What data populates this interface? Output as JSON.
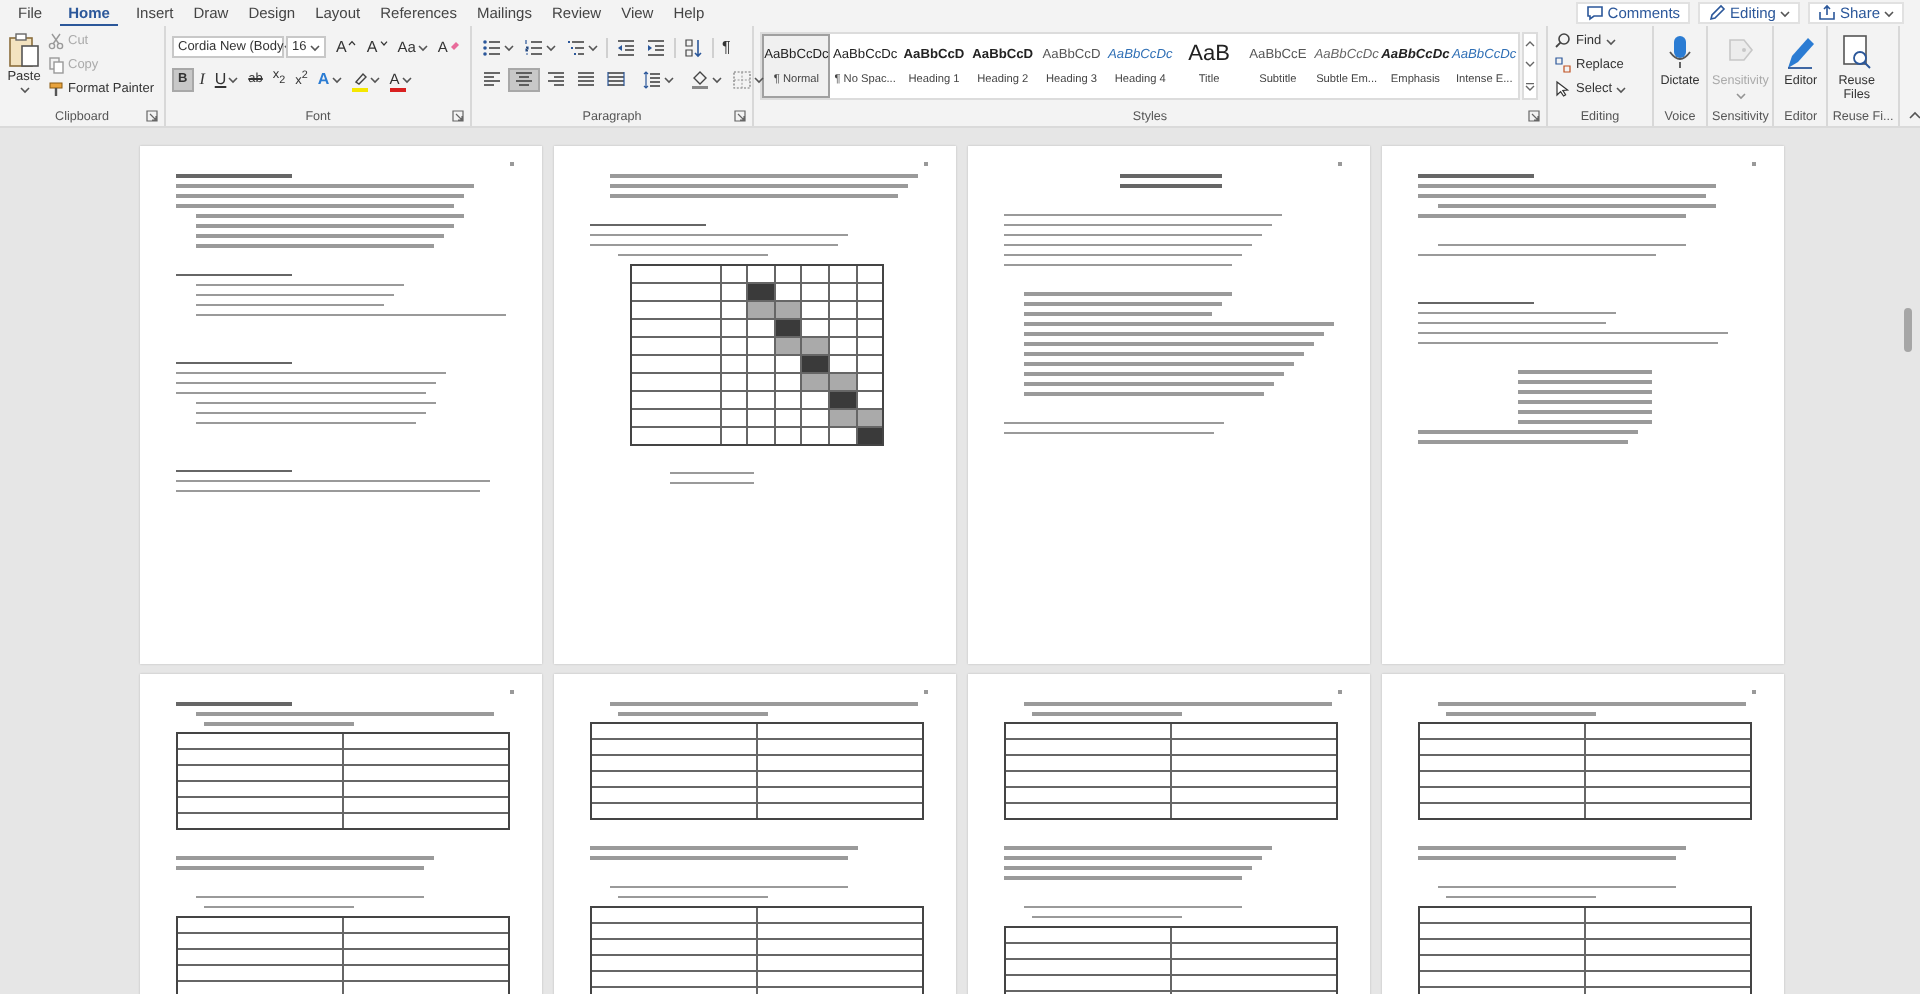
{
  "menu_tabs": [
    {
      "label": "File",
      "selected": false
    },
    {
      "label": "Home",
      "selected": true
    },
    {
      "label": "Insert",
      "selected": false
    },
    {
      "label": "Draw",
      "selected": false
    },
    {
      "label": "Design",
      "selected": false
    },
    {
      "label": "Layout",
      "selected": false
    },
    {
      "label": "References",
      "selected": false
    },
    {
      "label": "Mailings",
      "selected": false
    },
    {
      "label": "Review",
      "selected": false
    },
    {
      "label": "View",
      "selected": false
    },
    {
      "label": "Help",
      "selected": false
    }
  ],
  "header_buttons": [
    {
      "label": "Comments",
      "kind": "comments"
    },
    {
      "label": "Editing",
      "kind": "editing"
    },
    {
      "label": "Share",
      "kind": "share"
    }
  ],
  "clipboard": {
    "paste": "Paste",
    "label": "Clipboard",
    "items": [
      {
        "label": "Cut",
        "kind": "cut",
        "disabled": true
      },
      {
        "label": "Copy",
        "kind": "copy",
        "disabled": true
      },
      {
        "label": "Format Painter",
        "kind": "painter",
        "disabled": false
      }
    ]
  },
  "font": {
    "label": "Font",
    "font_name": "Cordia New (Body",
    "font_size": "16",
    "row1": [
      {
        "label": "A",
        "kind": "grow"
      },
      {
        "label": "A",
        "kind": "shrink"
      },
      {
        "label": "Aa",
        "kind": "case"
      },
      {
        "label": "A",
        "kind": "clear"
      }
    ],
    "row2": [
      {
        "label": "B",
        "kind": "bold",
        "selected": true
      },
      {
        "label": "I",
        "kind": "italic",
        "selected": false
      },
      {
        "label": "U",
        "kind": "underline",
        "selected": false
      },
      {
        "label": "ab",
        "kind": "strike",
        "selected": false
      },
      {
        "label": "x$_{2}$",
        "kind": "sub",
        "selected": false
      },
      {
        "label": "x$^{2}$",
        "kind": "sup",
        "selected": false
      },
      {
        "label": "A",
        "kind": "effects",
        "selected": false
      },
      {
        "kind": "highlight",
        "color": "#f5e700",
        "selected": false
      },
      {
        "label": "A",
        "kind": "color",
        "color": "#d92020",
        "selected": false
      }
    ]
  },
  "paragraph": {
    "label": "Paragraph",
    "row1": [
      {
        "kind": "bullets"
      },
      {
        "kind": "numbering"
      },
      {
        "kind": "multilevel"
      },
      {
        "kind": "outdent"
      },
      {
        "kind": "indent"
      },
      {
        "kind": "sort"
      },
      {
        "kind": "marks",
        "label": "¶"
      }
    ],
    "row2": [
      {
        "kind": "align-left",
        "selected": false
      },
      {
        "kind": "align-center",
        "selected": true
      },
      {
        "kind": "align-right",
        "selected": false
      },
      {
        "kind": "justify",
        "selected": false
      },
      {
        "kind": "distribute",
        "selected": false
      },
      {
        "kind": "spacing",
        "selected": false
      },
      {
        "kind": "shading",
        "selected": false
      },
      {
        "kind": "borders",
        "selected": false
      }
    ]
  },
  "styles": {
    "label": "Styles",
    "items": [
      {
        "preview": "AaBbCcDc",
        "name": "¶ Normal",
        "kind": "plain",
        "selected": true
      },
      {
        "preview": "AaBbCcDc",
        "name": "¶ No Spac...",
        "kind": "plain",
        "selected": false
      },
      {
        "preview": "AaBbCcD",
        "name": "Heading 1",
        "kind": "strong",
        "selected": false
      },
      {
        "preview": "AaBbCcD",
        "name": "Heading 2",
        "kind": "strong",
        "selected": false
      },
      {
        "preview": "AaBbCcD",
        "name": "Heading 3",
        "kind": "soft",
        "selected": false
      },
      {
        "preview": "AaBbCcDc",
        "name": "Heading 4",
        "kind": "accent",
        "selected": false
      },
      {
        "preview": "AaB",
        "name": "Title",
        "kind": "large",
        "selected": false
      },
      {
        "preview": "AaBbCcE",
        "name": "Subtitle",
        "kind": "soft",
        "selected": false
      },
      {
        "preview": "AaBbCcDc",
        "name": "Subtle Em...",
        "kind": "soft-italic",
        "selected": false
      },
      {
        "preview": "AaBbCcDc",
        "name": "Emphasis",
        "kind": "italic",
        "selected": false
      },
      {
        "preview": "AaBbCcDc",
        "name": "Intense E...",
        "kind": "accent",
        "selected": false
      }
    ]
  },
  "editing": {
    "label": "Editing",
    "items": [
      {
        "label": "Find",
        "kind": "find"
      },
      {
        "label": "Replace",
        "kind": "replace"
      },
      {
        "label": "Select",
        "kind": "select"
      }
    ]
  },
  "big_groups": [
    {
      "kind": "dictate",
      "button": "Dictate",
      "label": "Voice",
      "disabled": false
    },
    {
      "kind": "sensitivity",
      "button": "Sensitivity",
      "label": "Sensitivity",
      "disabled": true
    },
    {
      "kind": "editor",
      "button": "Editor",
      "label": "Editor",
      "disabled": false
    },
    {
      "kind": "reuse",
      "button": "Reuse Files",
      "label": "Reuse Fi...",
      "disabled": false
    }
  ]
}
